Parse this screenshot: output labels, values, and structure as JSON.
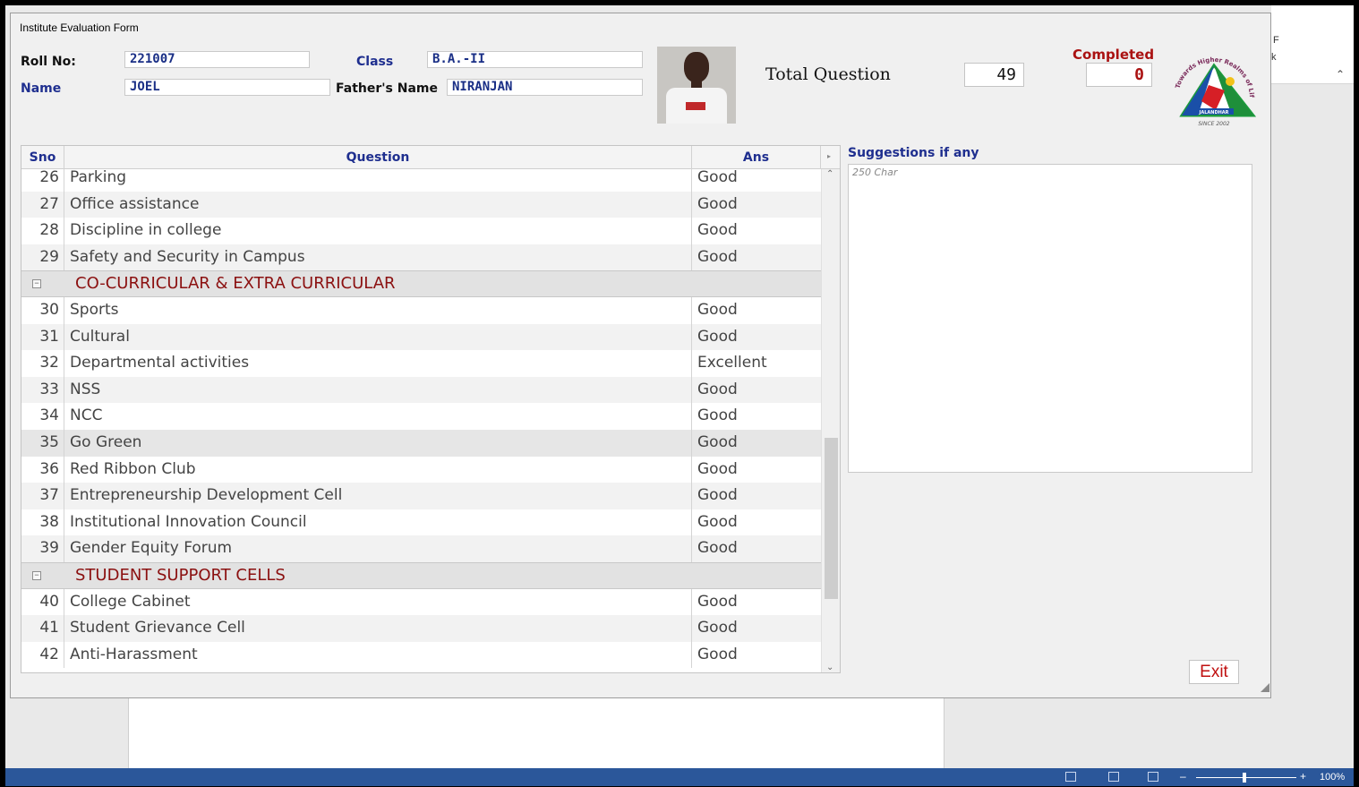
{
  "window": {
    "title": "Institute Evaluation Form"
  },
  "background": {
    "right_text_1": "F",
    "right_text_2": "k",
    "zoom": "100%"
  },
  "student": {
    "roll_label": "Roll No:",
    "roll_value": "221007",
    "class_label": "Class",
    "class_value": "B.A.-II",
    "name_label": "Name",
    "name_value": "JOEL",
    "father_label": "Father's Name",
    "father_value": "NIRANJAN"
  },
  "stats": {
    "total_label": "Total Question",
    "total_value": "49",
    "completed_label": "Completed",
    "completed_value": "0"
  },
  "emblem": {
    "arc_text": "Towards Higher Realms of Life",
    "city": "JALANDHAR",
    "since": "SINCE 2002"
  },
  "grid": {
    "headers": {
      "sno": "Sno",
      "question": "Question",
      "ans": "Ans"
    },
    "rows": [
      {
        "type": "item",
        "sno": "26",
        "q": "Parking",
        "a": "Good"
      },
      {
        "type": "item",
        "sno": "27",
        "q": "Office assistance",
        "a": "Good"
      },
      {
        "type": "item",
        "sno": "28",
        "q": "Discipline in college",
        "a": "Good"
      },
      {
        "type": "item",
        "sno": "29",
        "q": "Safety and Security in Campus",
        "a": "Good"
      },
      {
        "type": "group",
        "title": "CO-CURRICULAR  & EXTRA CURRICULAR"
      },
      {
        "type": "item",
        "sno": "30",
        "q": "Sports",
        "a": "Good"
      },
      {
        "type": "item",
        "sno": "31",
        "q": "Cultural",
        "a": "Good"
      },
      {
        "type": "item",
        "sno": "32",
        "q": "Departmental activities",
        "a": "Excellent"
      },
      {
        "type": "item",
        "sno": "33",
        "q": "NSS",
        "a": "Good"
      },
      {
        "type": "item",
        "sno": "34",
        "q": "NCC",
        "a": "Good"
      },
      {
        "type": "item",
        "sno": "35",
        "q": "Go Green",
        "a": "Good",
        "selected": true
      },
      {
        "type": "item",
        "sno": "36",
        "q": "Red Ribbon Club",
        "a": "Good"
      },
      {
        "type": "item",
        "sno": "37",
        "q": "Entrepreneurship Development Cell",
        "a": "Good"
      },
      {
        "type": "item",
        "sno": "38",
        "q": "Institutional Innovation Council",
        "a": "Good"
      },
      {
        "type": "item",
        "sno": "39",
        "q": "Gender Equity Forum",
        "a": "Good"
      },
      {
        "type": "group",
        "title": "STUDENT SUPPORT CELLS"
      },
      {
        "type": "item",
        "sno": "40",
        "q": "College Cabinet",
        "a": "Good"
      },
      {
        "type": "item",
        "sno": "41",
        "q": "Student Grievance Cell",
        "a": "Good"
      },
      {
        "type": "item",
        "sno": "42",
        "q": "Anti-Harassment",
        "a": "Good"
      }
    ]
  },
  "suggestions": {
    "label": "Suggestions if any",
    "placeholder": "250 Char"
  },
  "exit_label": "Exit",
  "colors": {
    "label_blue": "#1f2f8f",
    "group_red": "#8b1010",
    "exit_red": "#c01010",
    "taskbar": "#2b579a"
  }
}
